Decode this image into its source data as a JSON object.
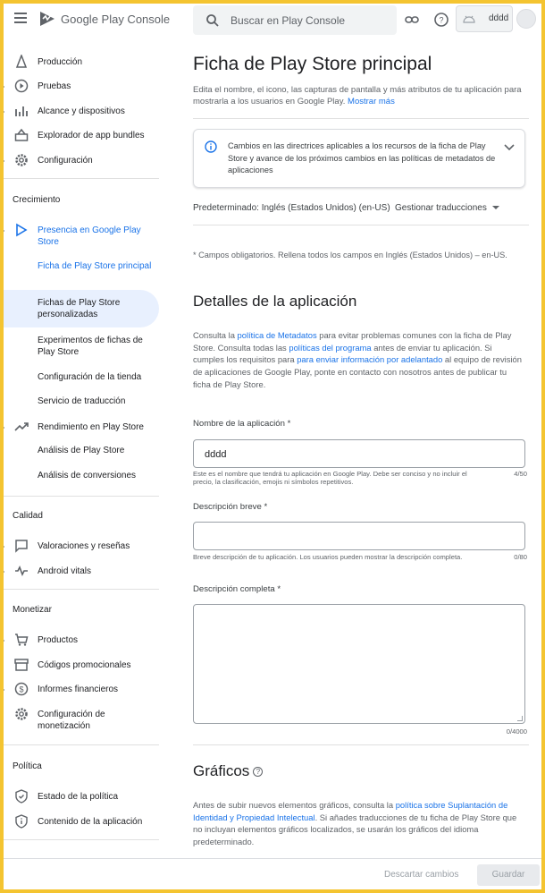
{
  "app": {
    "logo_text": "Google Play Console",
    "search_placeholder": "Buscar en Play Console",
    "app_name": "dddd"
  },
  "sidebar": {
    "top_items": [
      {
        "label": "Producción",
        "icon": "production-icon"
      },
      {
        "label": "Pruebas",
        "icon": "testing-icon"
      },
      {
        "label": "Alcance y dispositivos",
        "icon": "reach-icon"
      },
      {
        "label": "Explorador de app bundles",
        "icon": "bundle-icon"
      },
      {
        "label": "Configuración",
        "icon": "gear-icon"
      }
    ],
    "growth_title": "Crecimiento",
    "presence": "Presencia en Google Play Store",
    "presence_sub": [
      "Ficha de Play Store principal",
      "Fichas de Play Store personalizadas",
      "Experimentos de fichas de Play Store",
      "Configuración de la tienda",
      "Servicio de traducción"
    ],
    "performance": "Rendimiento en Play Store",
    "performance_sub": [
      "Análisis de Play Store",
      "Análisis de conversiones"
    ],
    "quality_title": "Calidad",
    "quality_items": [
      "Valoraciones y reseñas",
      "Android vitals"
    ],
    "monetize_title": "Monetizar",
    "monetize_items": [
      "Productos",
      "Códigos promocionales",
      "Informes financieros",
      "Configuración de monetización"
    ],
    "policy_title": "Política",
    "policy_items": [
      "Estado de la política",
      "Contenido de la aplicación"
    ]
  },
  "main": {
    "title": "Ficha de Play Store principal",
    "desc": "Edita el nombre, el icono, las capturas de pantalla y más atributos de tu aplicación para mostrarla a los usuarios en Google Play.",
    "learn_more": "Mostrar más",
    "notice": "Cambios en las directrices aplicables a los recursos de la ficha de Play Store y avance de los próximos cambios en las políticas de metadatos de aplicaciones",
    "default_lang": "Predeterminado: Inglés (Estados Unidos) (en-US)",
    "manage_translations": "Gestionar traducciones",
    "required_note": "* Campos obligatorios. Rellena todos los campos en Inglés (Estados Unidos) – en-US.",
    "details_title": "Detalles de la aplicación",
    "details_p1": "Consulta la ",
    "details_link1": "política de Metadatos",
    "details_p2": " para evitar problemas comunes con la ficha de Play Store. Consulta todas las ",
    "details_link2": "políticas del programa",
    "details_p3": " antes de enviar tu aplicación. Si cumples los requisitos para ",
    "details_link3": "para enviar información por adelantado",
    "details_p4": " al equipo de revisión de aplicaciones de Google Play, ponte en contacto con nosotros antes de publicar tu ficha de Play Store.",
    "name_label": "Nombre de la aplicación  *",
    "name_value": "dddd",
    "name_hint": "Este es el nombre que tendrá tu aplicación en Google Play. Debe ser conciso y no incluir el precio, la clasificación, emojis ni símbolos repetitivos.",
    "name_counter": "4/50",
    "short_label": "Descripción breve  *",
    "short_hint": "Breve descripción de tu aplicación. Los usuarios pueden mostrar la descripción completa.",
    "short_counter": "0/80",
    "full_label": "Descripción completa  *",
    "full_counter": "0/4000",
    "graphics_title": "Gráficos",
    "graphics_p1": "Antes de subir nuevos elementos gráficos, consulta la ",
    "graphics_link": "política sobre Suplantación de Identidad y Propiedad Intelectual",
    "graphics_p2": ". Si añades traducciones de tu ficha de Play Store que no incluyan elementos gráficos localizados, se usarán los gráficos del idioma predeterminado."
  },
  "footer": {
    "discard": "Descartar cambios",
    "save": "Guardar"
  },
  "colors": {
    "accent": "#1a73e8",
    "active_bg": "#e8f0fe",
    "frame": "#f4c430"
  }
}
